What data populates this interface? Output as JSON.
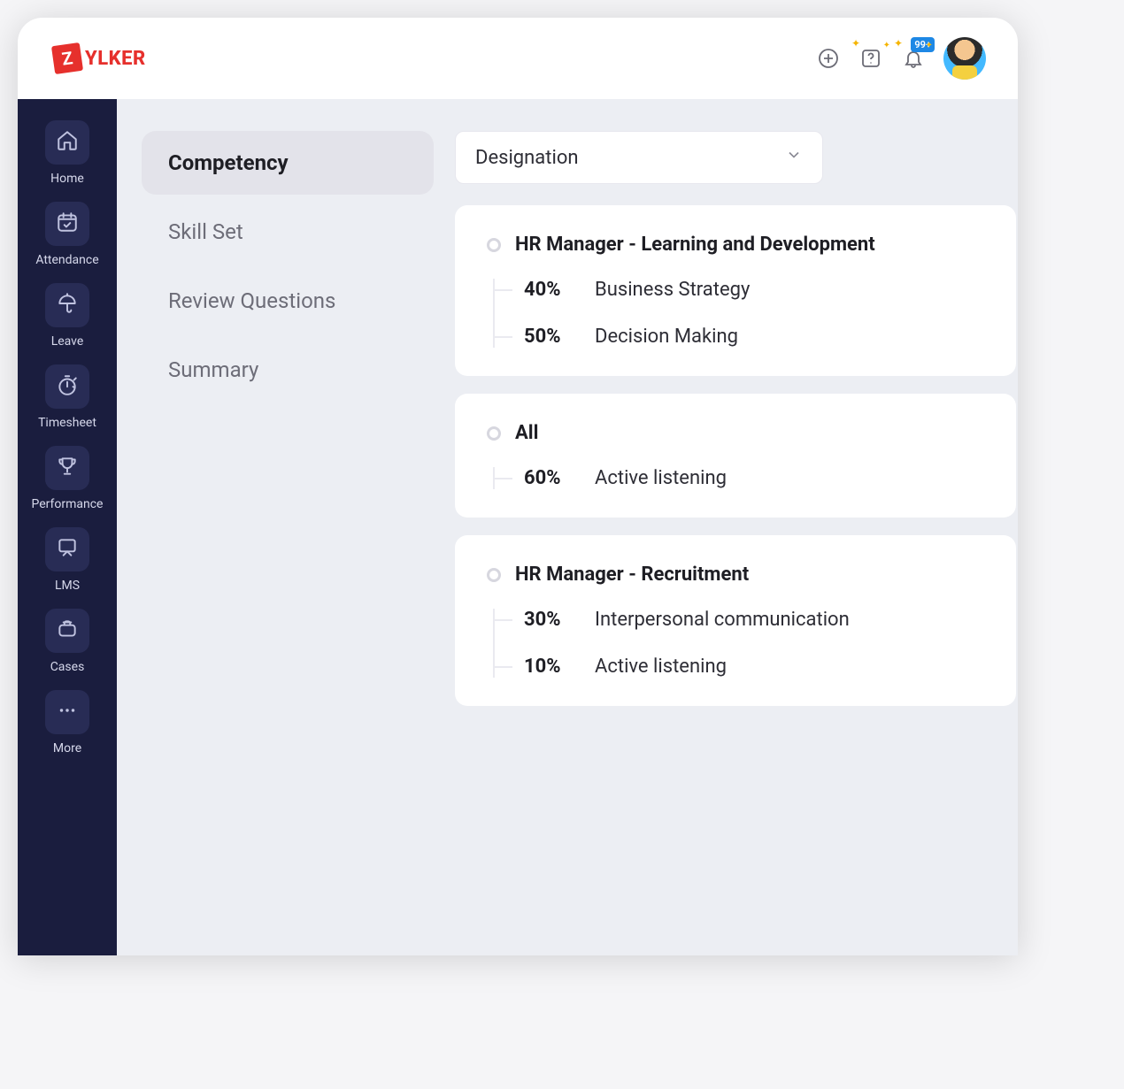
{
  "logo": {
    "z": "Z",
    "text": "YLKER"
  },
  "header": {
    "notification_badge": "99+"
  },
  "sidebar": {
    "items": [
      {
        "label": "Home"
      },
      {
        "label": "Attendance"
      },
      {
        "label": "Leave"
      },
      {
        "label": "Timesheet"
      },
      {
        "label": "Performance"
      },
      {
        "label": "LMS"
      },
      {
        "label": "Cases"
      },
      {
        "label": "More"
      }
    ]
  },
  "subnav": {
    "items": [
      {
        "label": "Competency"
      },
      {
        "label": "Skill Set"
      },
      {
        "label": "Review Questions"
      },
      {
        "label": "Summary"
      }
    ]
  },
  "dropdown": {
    "selected": "Designation"
  },
  "cards": [
    {
      "title": "HR Manager - Learning and Development",
      "items": [
        {
          "pct": "40%",
          "name": "Business Strategy"
        },
        {
          "pct": "50%",
          "name": "Decision Making"
        }
      ]
    },
    {
      "title": "All",
      "items": [
        {
          "pct": "60%",
          "name": "Active listening"
        }
      ]
    },
    {
      "title": "HR Manager - Recruitment",
      "items": [
        {
          "pct": "30%",
          "name": "Interpersonal communication"
        },
        {
          "pct": "10%",
          "name": "Active listening"
        }
      ]
    }
  ]
}
